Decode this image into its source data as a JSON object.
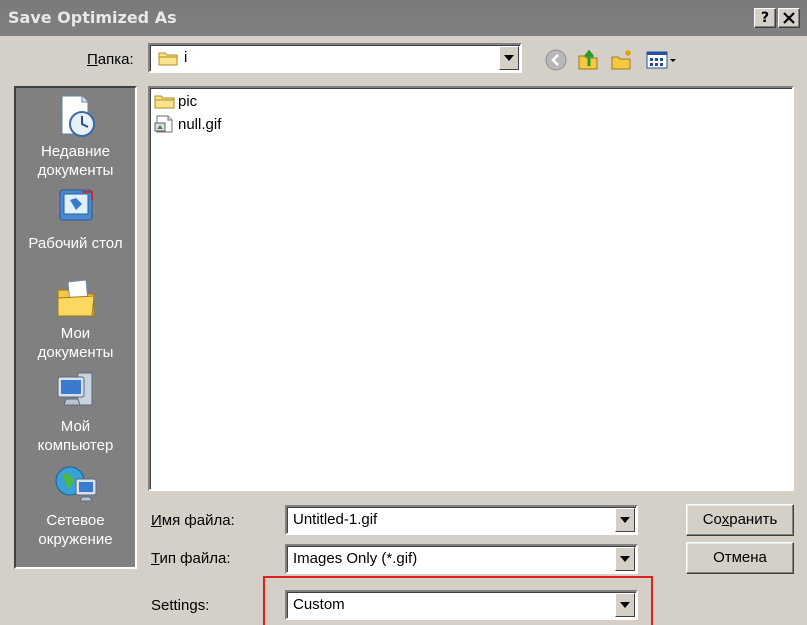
{
  "window": {
    "title": "Save Optimized As",
    "help_button": "?",
    "close_button": "X"
  },
  "folder": {
    "label": "Папка:",
    "current": "i"
  },
  "toolbar": {
    "icons": [
      "back-icon",
      "up-folder-icon",
      "new-folder-icon",
      "view-menu-icon"
    ]
  },
  "places": [
    {
      "label_line1": "Недавние",
      "label_line2": "документы",
      "icon": "recent-documents-icon"
    },
    {
      "label_line1": "Рабочий стол",
      "label_line2": "",
      "icon": "desktop-icon"
    },
    {
      "label_line1": "Мои",
      "label_line2": "документы",
      "icon": "my-documents-icon"
    },
    {
      "label_line1": "Мой",
      "label_line2": "компьютер",
      "icon": "my-computer-icon"
    },
    {
      "label_line1": "Сетевое",
      "label_line2": "окружение",
      "icon": "network-icon"
    }
  ],
  "files": [
    {
      "name": "pic",
      "icon": "folder-icon"
    },
    {
      "name": "null.gif",
      "icon": "gif-file-icon"
    }
  ],
  "filename": {
    "label_first": "И",
    "label_rest": "мя файла:",
    "value": "Untitled-1.gif"
  },
  "filetype": {
    "label_first": "Т",
    "label_rest": "ип файла:",
    "value": "Images Only (*.gif)"
  },
  "settings": {
    "label": "Settings:",
    "value": "Custom"
  },
  "buttons": {
    "save_pre": "Со",
    "save_key": "х",
    "save_post": "ранить",
    "cancel": "Отмена"
  },
  "colors": {
    "dialog_bg": "#d4d0c8",
    "title_bg": "#808080",
    "places_bg": "#808080",
    "highlight_box": "#e02020"
  }
}
